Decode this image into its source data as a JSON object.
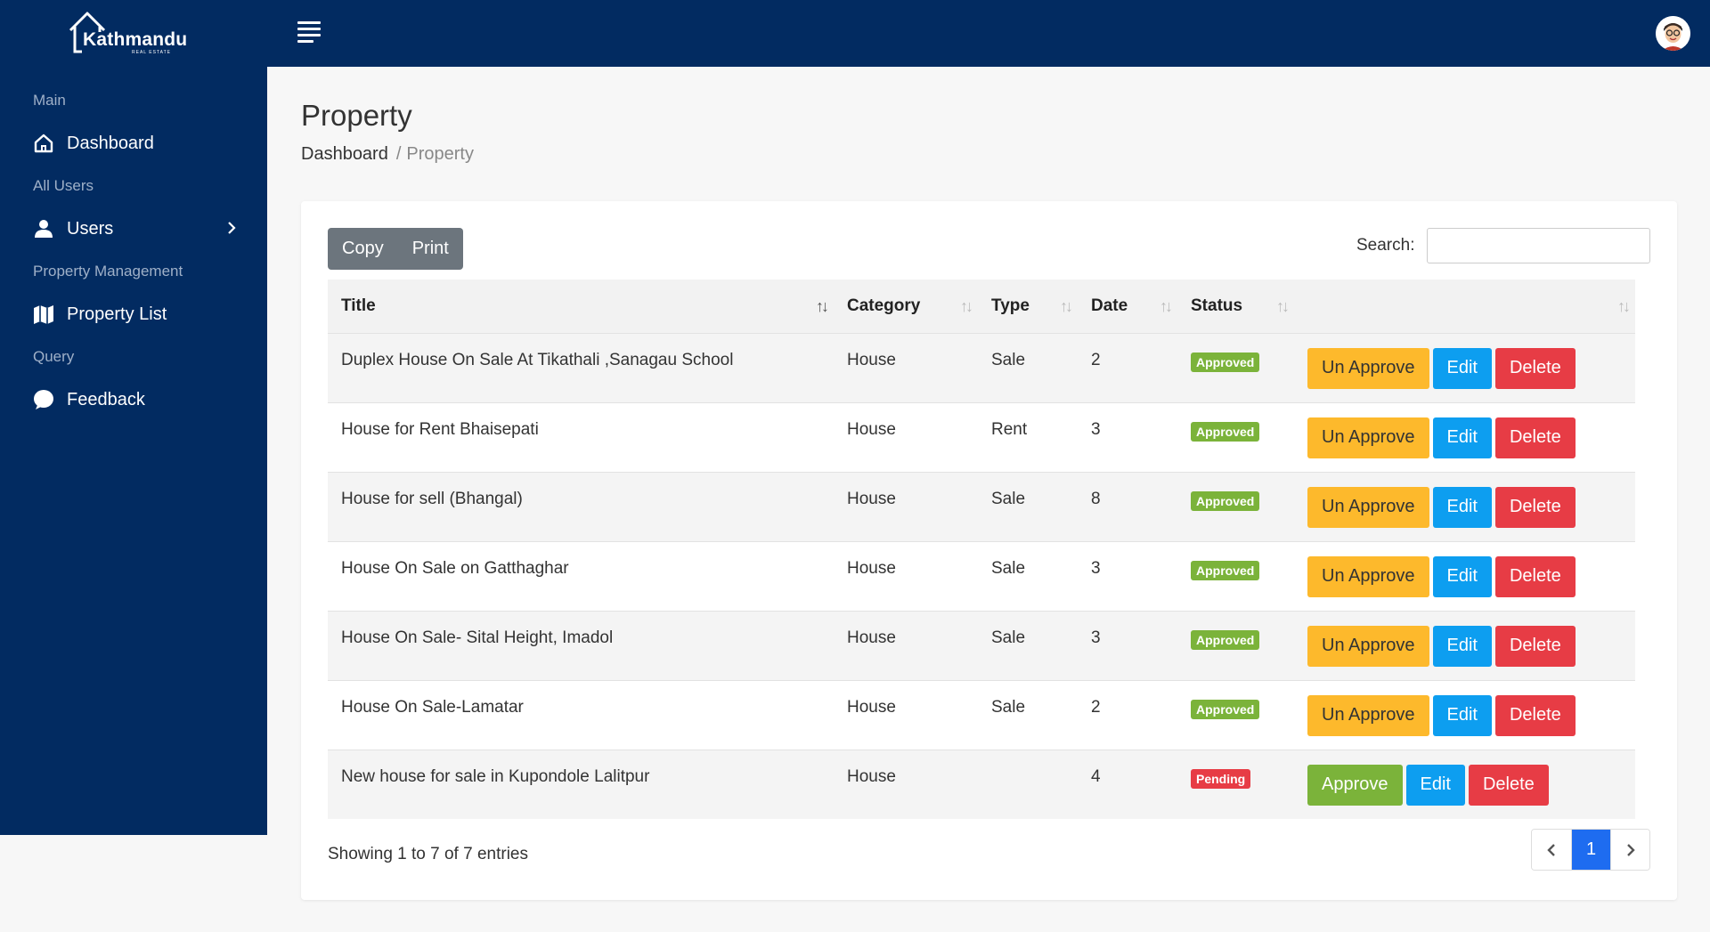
{
  "header": {
    "logo_text": "Kathmandu",
    "logo_sub": "REAL ESTATE"
  },
  "sidebar": {
    "sections": [
      {
        "label": "Main"
      },
      {
        "label": "All Users"
      },
      {
        "label": "Property Management"
      },
      {
        "label": "Query"
      }
    ],
    "items": [
      {
        "label": "Dashboard",
        "icon": "home-icon"
      },
      {
        "label": "Users",
        "icon": "user-icon"
      },
      {
        "label": "Property List",
        "icon": "map-icon"
      },
      {
        "label": "Feedback",
        "icon": "chat-bubble-icon"
      }
    ]
  },
  "page": {
    "title": "Property",
    "breadcrumb": [
      "Dashboard",
      "Property"
    ]
  },
  "toolbar": {
    "copy_label": "Copy",
    "print_label": "Print",
    "search_label": "Search:",
    "search_value": ""
  },
  "table": {
    "columns": [
      "Title",
      "Category",
      "Type",
      "Date",
      "Status",
      ""
    ],
    "rows": [
      {
        "title": "Duplex House On Sale At Tikathali ,Sanagau School",
        "category": "House",
        "type": "Sale",
        "date": "2",
        "status": "Approved",
        "action": "Un Approve"
      },
      {
        "title": "House for Rent Bhaisepati",
        "category": "House",
        "type": "Rent",
        "date": "3",
        "status": "Approved",
        "action": "Un Approve"
      },
      {
        "title": "House for sell (Bhangal)",
        "category": "House",
        "type": "Sale",
        "date": "8",
        "status": "Approved",
        "action": "Un Approve"
      },
      {
        "title": "House On Sale on Gatthaghar",
        "category": "House",
        "type": "Sale",
        "date": "3",
        "status": "Approved",
        "action": "Un Approve"
      },
      {
        "title": "House On Sale- Sital Height, Imadol",
        "category": "House",
        "type": "Sale",
        "date": "3",
        "status": "Approved",
        "action": "Un Approve"
      },
      {
        "title": "House On Sale-Lamatar",
        "category": "House",
        "type": "Sale",
        "date": "2",
        "status": "Approved",
        "action": "Un Approve"
      },
      {
        "title": "New house for sale in Kupondole Lalitpur",
        "category": "House",
        "type": "",
        "date": "4",
        "status": "Pending",
        "action": "Approve"
      }
    ],
    "edit_label": "Edit",
    "delete_label": "Delete"
  },
  "footer": {
    "info": "Showing 1 to 7 of 7 entries",
    "current_page": "1"
  },
  "colors": {
    "navy": "#022b61",
    "approved": "#7bb33a",
    "pending": "#e73c45",
    "warning": "#fdb92c",
    "info": "#0d9ef0",
    "primary": "#1e6cf0"
  }
}
